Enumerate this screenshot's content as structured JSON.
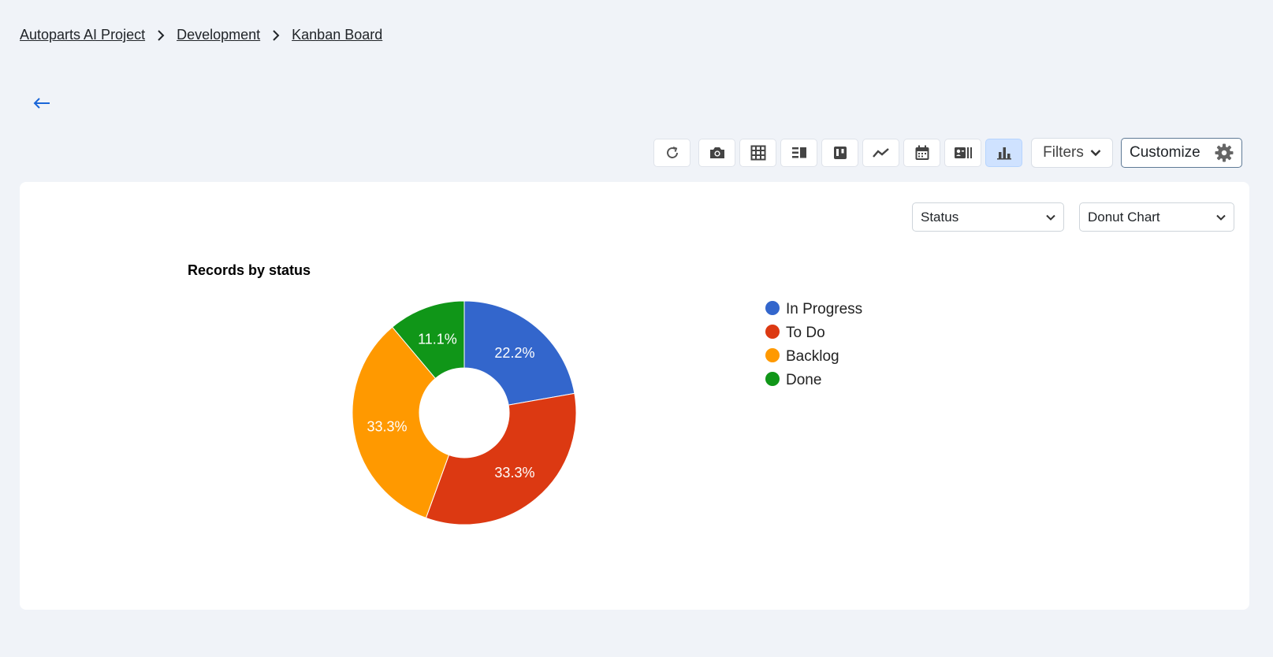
{
  "breadcrumb": {
    "items": [
      "Autoparts AI Project",
      "Development",
      "Kanban Board"
    ]
  },
  "toolbar": {
    "views": [
      {
        "name": "refresh-icon"
      },
      {
        "name": "camera-icon"
      },
      {
        "name": "table-view-icon"
      },
      {
        "name": "list-view-icon"
      },
      {
        "name": "kanban-view-icon"
      },
      {
        "name": "timeline-view-icon"
      },
      {
        "name": "calendar-view-icon"
      },
      {
        "name": "gallery-view-icon"
      },
      {
        "name": "chart-view-icon",
        "active": true
      }
    ],
    "filters_label": "Filters",
    "customize_label": "Customize"
  },
  "controls": {
    "group_by": "Status",
    "chart_type": "Donut Chart"
  },
  "colors": {
    "accent": "#1a66d8",
    "active_bg": "#cfe2ff"
  },
  "chart_data": {
    "type": "pie",
    "variant": "donut",
    "title": "Records by status",
    "legend_position": "right",
    "slices": [
      {
        "label": "In Progress",
        "percent": 22.2,
        "value_label": "22.2%",
        "color": "#3366cc"
      },
      {
        "label": "To Do",
        "percent": 33.3,
        "value_label": "33.3%",
        "color": "#dc3912"
      },
      {
        "label": "Backlog",
        "percent": 33.3,
        "value_label": "33.3%",
        "color": "#ff9900"
      },
      {
        "label": "Done",
        "percent": 11.1,
        "value_label": "11.1%",
        "color": "#109618"
      }
    ]
  }
}
